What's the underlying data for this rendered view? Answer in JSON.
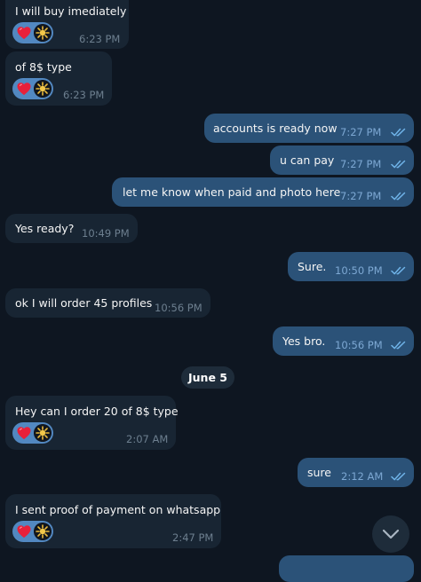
{
  "messages": [
    {
      "direction": "in",
      "text": "I will buy imediately",
      "time": "6:23 PM",
      "reactions": [
        "heart",
        "user-avatar"
      ]
    },
    {
      "direction": "in",
      "text": "of 8$ type",
      "time": "6:23 PM",
      "reactions": [
        "heart",
        "user-avatar"
      ]
    },
    {
      "direction": "out",
      "text": "accounts is ready now",
      "time": "7:27 PM",
      "status": "read"
    },
    {
      "direction": "out",
      "text": "u can pay",
      "time": "7:27 PM",
      "status": "read"
    },
    {
      "direction": "out",
      "text": "let me know when paid and photo here",
      "time": "7:27 PM",
      "status": "read"
    },
    {
      "direction": "in",
      "text": "Yes ready?",
      "time": "10:49 PM"
    },
    {
      "direction": "out",
      "text": "Sure.",
      "time": "10:50 PM",
      "status": "read"
    },
    {
      "direction": "in",
      "text": "ok I will order 45 profiles",
      "time": "10:56 PM"
    },
    {
      "direction": "out",
      "text": "Yes bro.",
      "time": "10:56 PM",
      "status": "read"
    },
    {
      "direction": "in",
      "text": "Hey can I order 20 of 8$ type",
      "time": "2:07 AM",
      "reactions": [
        "heart",
        "user-avatar"
      ]
    },
    {
      "direction": "out",
      "text": "sure",
      "time": "2:12 AM",
      "status": "read"
    },
    {
      "direction": "in",
      "text": "I sent proof of payment on whatsapp",
      "time": "2:47 PM",
      "reactions": [
        "heart",
        "user-avatar"
      ]
    }
  ],
  "date_separator": "June 5",
  "colors": {
    "background": "#0e1621",
    "incoming_bubble": "#182533",
    "outgoing_bubble": "#2b5278",
    "reaction_pill": "#5288c1",
    "read_ticks": "#6fb3e8"
  },
  "icons": {
    "reaction_heart": "heart-icon",
    "reaction_avatar": "user-avatar",
    "read_status": "double-check-icon",
    "scroll_down": "chevron-down-icon"
  }
}
